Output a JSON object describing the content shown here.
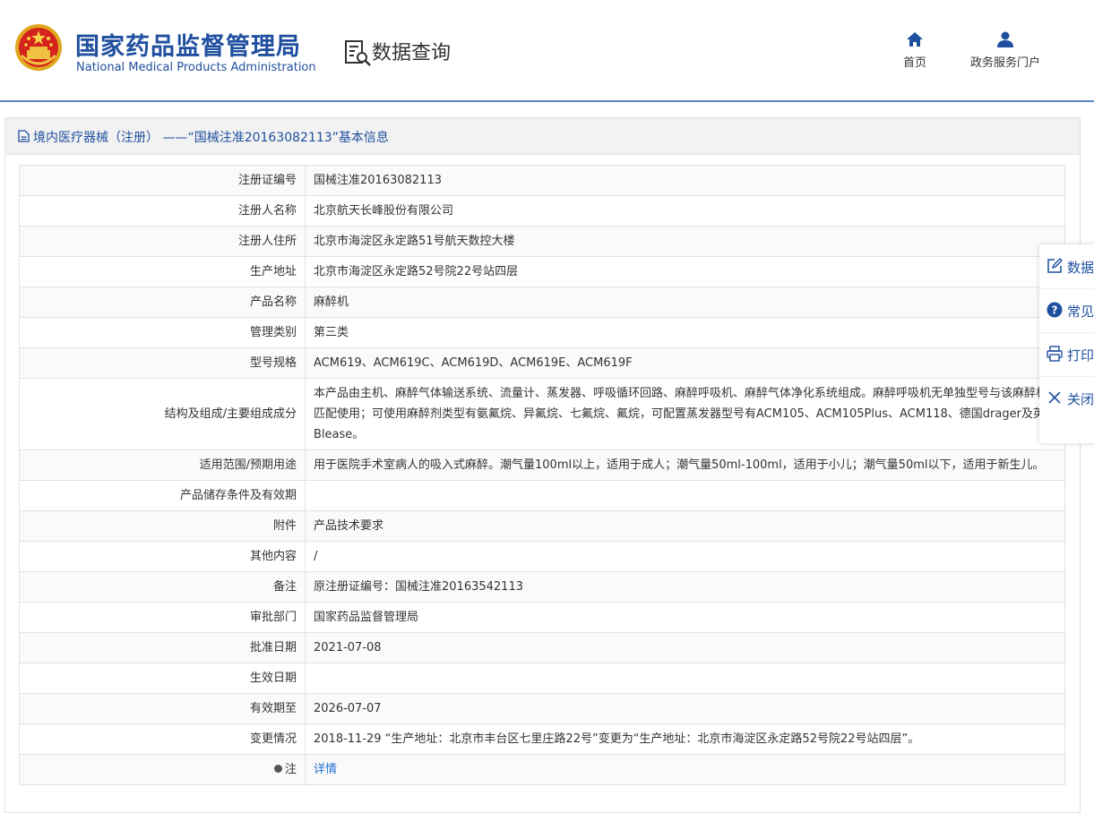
{
  "header": {
    "org_name_cn": "国家药品监督管理局",
    "org_name_en": "National Medical Products Administration",
    "section_title": "数据查询",
    "nav": [
      {
        "label": "首页",
        "icon": "home-icon"
      },
      {
        "label": "政务服务门户",
        "icon": "user-icon"
      }
    ]
  },
  "panel": {
    "title": "境内医疗器械（注册） ——“国械注准20163082113”基本信息"
  },
  "rows": [
    {
      "label": "注册证编号",
      "value": "国械注准20163082113"
    },
    {
      "label": "注册人名称",
      "value": "北京航天长峰股份有限公司"
    },
    {
      "label": "注册人住所",
      "value": "北京市海淀区永定路51号航天数控大楼"
    },
    {
      "label": "生产地址",
      "value": "北京市海淀区永定路52号院22号站四层"
    },
    {
      "label": "产品名称",
      "value": "麻醉机"
    },
    {
      "label": "管理类别",
      "value": "第三类"
    },
    {
      "label": "型号规格",
      "value": "ACM619、ACM619C、ACM619D、ACM619E、ACM619F"
    },
    {
      "label": "结构及组成/主要组成成分",
      "value": "本产品由主机、麻醉气体输送系统、流量计、蒸发器、呼吸循环回路、麻醉呼吸机、麻醉气体净化系统组成。麻醉呼吸机无单独型号与该麻醉机匹配使用；可使用麻醉剂类型有氨氟烷、异氟烷、七氟烷、氟烷，可配置蒸发器型号有ACM105、ACM105Plus、ACM118、德国drager及英国Blease。"
    },
    {
      "label": "适用范围/预期用途",
      "value": "用于医院手术室病人的吸入式麻醉。潮气量100ml以上，适用于成人；潮气量50ml-100ml，适用于小儿；潮气量50ml以下，适用于新生儿。"
    },
    {
      "label": "产品储存条件及有效期",
      "value": ""
    },
    {
      "label": "附件",
      "value": "产品技术要求"
    },
    {
      "label": "其他内容",
      "value": "/"
    },
    {
      "label": "备注",
      "value": "原注册证编号：国械注准20163542113"
    },
    {
      "label": "审批部门",
      "value": "国家药品监督管理局"
    },
    {
      "label": "批准日期",
      "value": "2021-07-08"
    },
    {
      "label": "生效日期",
      "value": ""
    },
    {
      "label": "有效期至",
      "value": "2026-07-07"
    },
    {
      "label": "变更情况",
      "value": "2018-11-29 “生产地址：北京市丰台区七里庄路22号”变更为“生产地址：北京市海淀区永定路52号院22号站四层”。"
    },
    {
      "label": "注",
      "value": "详情"
    }
  ],
  "sidebar": [
    {
      "label": "数据",
      "icon": "edit-icon"
    },
    {
      "label": "常见",
      "icon": "question-icon"
    },
    {
      "label": "打印",
      "icon": "print-icon"
    },
    {
      "label": "关闭",
      "icon": "close-icon"
    }
  ]
}
